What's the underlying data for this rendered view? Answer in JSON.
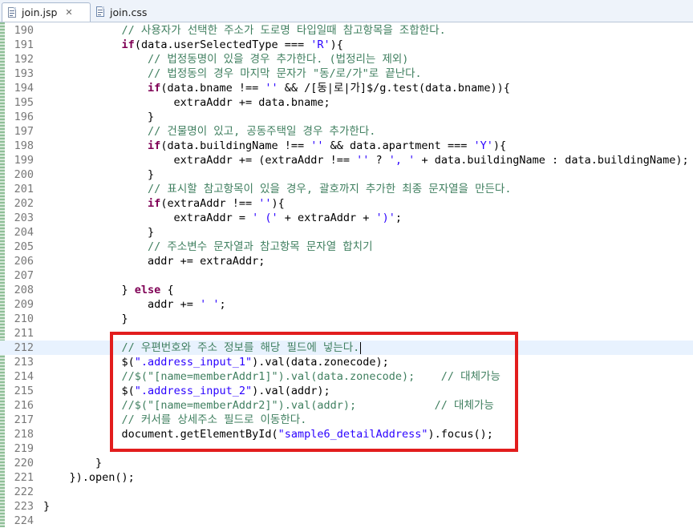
{
  "tabs": [
    {
      "label": "join.jsp",
      "close": "✕"
    },
    {
      "label": "join.css"
    }
  ],
  "lines": [
    {
      "n": "190",
      "segs": [
        {
          "t": "            "
        },
        {
          "t": "// 사용자가 선택한 주소가 도로명 타입일때 참고항목을 조합한다.",
          "c": "cm"
        }
      ]
    },
    {
      "n": "191",
      "segs": [
        {
          "t": "            "
        },
        {
          "t": "if",
          "c": "kw"
        },
        {
          "t": "(data.userSelectedType === "
        },
        {
          "t": "'R'",
          "c": "st"
        },
        {
          "t": "){"
        }
      ]
    },
    {
      "n": "192",
      "segs": [
        {
          "t": "                "
        },
        {
          "t": "// 법정동명이 있을 경우 추가한다. (법정리는 제외)",
          "c": "cm"
        }
      ]
    },
    {
      "n": "193",
      "segs": [
        {
          "t": "                "
        },
        {
          "t": "// 법정동의 경우 마지막 문자가 \"동/로/가\"로 끝난다.",
          "c": "cm"
        }
      ]
    },
    {
      "n": "194",
      "segs": [
        {
          "t": "                "
        },
        {
          "t": "if",
          "c": "kw"
        },
        {
          "t": "(data.bname !== "
        },
        {
          "t": "''",
          "c": "st"
        },
        {
          "t": " && /[동|로|가]$/g.test(data.bname)){"
        }
      ]
    },
    {
      "n": "195",
      "segs": [
        {
          "t": "                    extraAddr += data.bname;"
        }
      ]
    },
    {
      "n": "196",
      "segs": [
        {
          "t": "                }"
        }
      ]
    },
    {
      "n": "197",
      "segs": [
        {
          "t": "                "
        },
        {
          "t": "// 건물명이 있고, 공동주택일 경우 추가한다.",
          "c": "cm"
        }
      ]
    },
    {
      "n": "198",
      "segs": [
        {
          "t": "                "
        },
        {
          "t": "if",
          "c": "kw"
        },
        {
          "t": "(data.buildingName !== "
        },
        {
          "t": "''",
          "c": "st"
        },
        {
          "t": " && data.apartment === "
        },
        {
          "t": "'Y'",
          "c": "st"
        },
        {
          "t": "){"
        }
      ]
    },
    {
      "n": "199",
      "segs": [
        {
          "t": "                    extraAddr += (extraAddr !== "
        },
        {
          "t": "''",
          "c": "st"
        },
        {
          "t": " ? "
        },
        {
          "t": "', '",
          "c": "st"
        },
        {
          "t": " + data.buildingName : data.buildingName);"
        }
      ]
    },
    {
      "n": "200",
      "segs": [
        {
          "t": "                }"
        }
      ]
    },
    {
      "n": "201",
      "segs": [
        {
          "t": "                "
        },
        {
          "t": "// 표시할 참고항목이 있을 경우, 괄호까지 추가한 최종 문자열을 만든다.",
          "c": "cm"
        }
      ]
    },
    {
      "n": "202",
      "segs": [
        {
          "t": "                "
        },
        {
          "t": "if",
          "c": "kw"
        },
        {
          "t": "(extraAddr !== "
        },
        {
          "t": "''",
          "c": "st"
        },
        {
          "t": "){"
        }
      ]
    },
    {
      "n": "203",
      "segs": [
        {
          "t": "                    extraAddr = "
        },
        {
          "t": "' ('",
          "c": "st"
        },
        {
          "t": " + extraAddr + "
        },
        {
          "t": "')'",
          "c": "st"
        },
        {
          "t": ";"
        }
      ]
    },
    {
      "n": "204",
      "segs": [
        {
          "t": "                }"
        }
      ]
    },
    {
      "n": "205",
      "segs": [
        {
          "t": "                "
        },
        {
          "t": "// 주소변수 문자열과 참고항목 문자열 합치기",
          "c": "cm"
        }
      ]
    },
    {
      "n": "206",
      "segs": [
        {
          "t": "                addr += extraAddr;"
        }
      ]
    },
    {
      "n": "207",
      "segs": [
        {
          "t": ""
        }
      ]
    },
    {
      "n": "208",
      "segs": [
        {
          "t": "            } "
        },
        {
          "t": "else",
          "c": "kw"
        },
        {
          "t": " {"
        }
      ]
    },
    {
      "n": "209",
      "segs": [
        {
          "t": "                addr += "
        },
        {
          "t": "' '",
          "c": "st"
        },
        {
          "t": ";"
        }
      ]
    },
    {
      "n": "210",
      "segs": [
        {
          "t": "            }"
        }
      ]
    },
    {
      "n": "211",
      "segs": [
        {
          "t": ""
        }
      ]
    },
    {
      "n": "212",
      "current": true,
      "segs": [
        {
          "t": "            "
        },
        {
          "t": "// 우편번호와 주소 정보를 해당 필드에 넣는다.",
          "c": "cm"
        }
      ]
    },
    {
      "n": "213",
      "segs": [
        {
          "t": "            $("
        },
        {
          "t": "\".address_input_1\"",
          "c": "st"
        },
        {
          "t": ").val(data.zonecode);"
        }
      ]
    },
    {
      "n": "214",
      "segs": [
        {
          "t": "            "
        },
        {
          "t": "//$(\"[name=memberAddr1]\").val(data.zonecode);    // 대체가능",
          "c": "cm"
        }
      ]
    },
    {
      "n": "215",
      "segs": [
        {
          "t": "            $("
        },
        {
          "t": "\".address_input_2\"",
          "c": "st"
        },
        {
          "t": ").val(addr);"
        }
      ]
    },
    {
      "n": "216",
      "segs": [
        {
          "t": "            "
        },
        {
          "t": "//$(\"[name=memberAddr2]\").val(addr);            // 대체가능",
          "c": "cm"
        }
      ]
    },
    {
      "n": "217",
      "segs": [
        {
          "t": "            "
        },
        {
          "t": "// 커서를 상세주소 필드로 이동한다.",
          "c": "cm"
        }
      ]
    },
    {
      "n": "218",
      "segs": [
        {
          "t": "            document.getElementById("
        },
        {
          "t": "\"sample6_detailAddress\"",
          "c": "st"
        },
        {
          "t": ").focus();"
        }
      ]
    },
    {
      "n": "219",
      "segs": [
        {
          "t": ""
        }
      ]
    },
    {
      "n": "220",
      "segs": [
        {
          "t": "        }"
        }
      ]
    },
    {
      "n": "221",
      "segs": [
        {
          "t": "    }).open();"
        }
      ]
    },
    {
      "n": "222",
      "segs": [
        {
          "t": ""
        }
      ]
    },
    {
      "n": "223",
      "segs": [
        {
          "t": "}"
        }
      ]
    },
    {
      "n": "224",
      "segs": [
        {
          "t": ""
        }
      ]
    }
  ]
}
